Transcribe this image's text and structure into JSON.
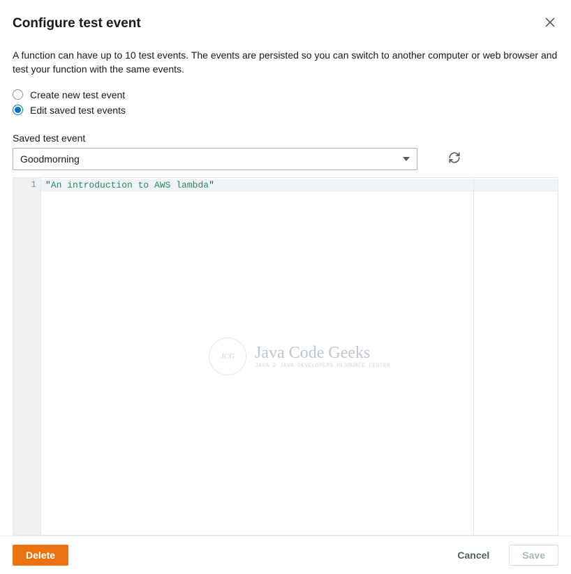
{
  "header": {
    "title": "Configure test event"
  },
  "description": "A function can have up to 10 test events. The events are persisted so you can switch to another computer or web browser and test your function with the same events.",
  "radios": {
    "create_label": "Create new test event",
    "edit_label": "Edit saved test events",
    "selected": "edit"
  },
  "saved_event": {
    "label": "Saved test event",
    "selected": "Goodmorning"
  },
  "editor": {
    "lines": [
      {
        "num": "1",
        "quote_open": "\"",
        "content": "An introduction to AWS lambda",
        "quote_close": "\""
      }
    ]
  },
  "watermark": {
    "badge": "JCG",
    "title": "Java Code Geeks",
    "subtitle": "Java 2 Java Developers Resource Center"
  },
  "footer": {
    "delete": "Delete",
    "cancel": "Cancel",
    "save": "Save"
  }
}
